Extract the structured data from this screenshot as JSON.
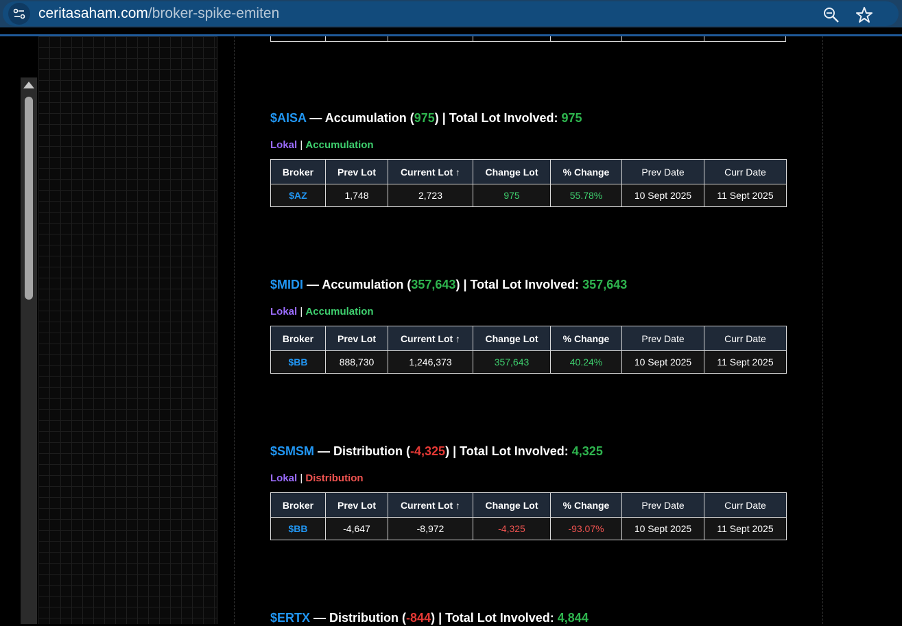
{
  "browser": {
    "domain": "ceritasaham.com",
    "path": "/broker-spike-emiten",
    "site_icon": "tune-icon",
    "zoom_icon": "zoom-icon",
    "star_icon": "bookmark-star-icon"
  },
  "colors": {
    "ticker": "#2196f3",
    "positive": "#2eb44e",
    "negative": "#e53935",
    "lokal": "#9b6cff",
    "header_bg": "#1f2937"
  },
  "table_headers": {
    "broker": "Broker",
    "prev_lot": "Prev Lot",
    "current_lot": "Current Lot ↑",
    "change_lot": "Change Lot",
    "pct_change": "% Change",
    "prev_date": "Prev Date",
    "curr_date": "Curr Date"
  },
  "labels": {
    "dash": " — ",
    "open_paren": " (",
    "close_paren": ")",
    "total_lot": " | Total Lot Involved: ",
    "pipe": " | "
  },
  "sections": [
    {
      "ticker": "$AISA",
      "type": "Accumulation",
      "net": "975",
      "total": "975",
      "origin": "Lokal",
      "rows": [
        {
          "broker": "$AZ",
          "prev_lot": "1,748",
          "current_lot": "2,723",
          "change_lot": "975",
          "pct_change": "55.78%",
          "prev_date": "10 Sept 2025",
          "curr_date": "11 Sept 2025"
        }
      ]
    },
    {
      "ticker": "$MIDI",
      "type": "Accumulation",
      "net": "357,643",
      "total": "357,643",
      "origin": "Lokal",
      "rows": [
        {
          "broker": "$BB",
          "prev_lot": "888,730",
          "current_lot": "1,246,373",
          "change_lot": "357,643",
          "pct_change": "40.24%",
          "prev_date": "10 Sept 2025",
          "curr_date": "11 Sept 2025"
        }
      ]
    },
    {
      "ticker": "$SMSM",
      "type": "Distribution",
      "net": "-4,325",
      "total": "4,325",
      "origin": "Lokal",
      "rows": [
        {
          "broker": "$BB",
          "prev_lot": "-4,647",
          "current_lot": "-8,972",
          "change_lot": "-4,325",
          "pct_change": "-93.07%",
          "prev_date": "10 Sept 2025",
          "curr_date": "11 Sept 2025"
        }
      ]
    },
    {
      "ticker": "$ERTX",
      "type": "Distribution",
      "net": "-844",
      "total": "4,844"
    }
  ]
}
